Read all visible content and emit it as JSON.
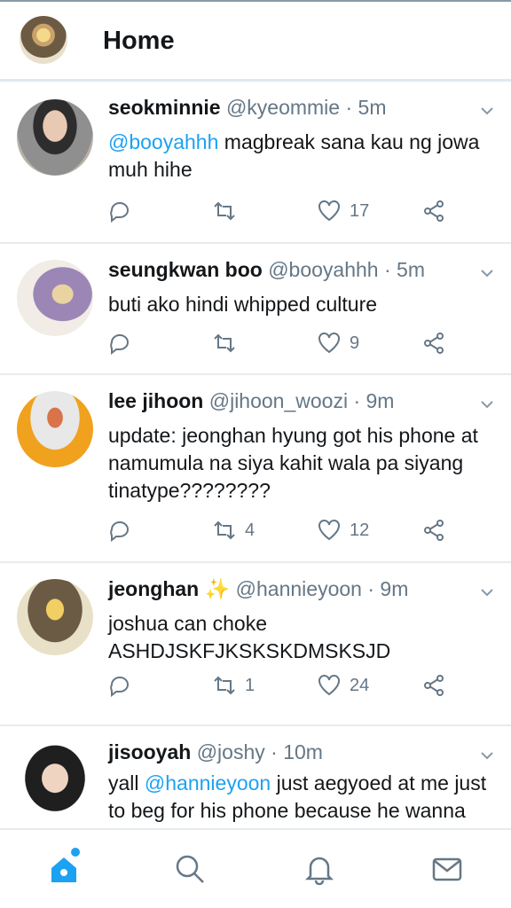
{
  "header": {
    "title": "Home"
  },
  "tweets": [
    {
      "name": "seokminnie",
      "handle": "@kyeommie",
      "dot": "·",
      "time": "5m",
      "mention": "@booyahhh",
      "text": " magbreak sana kau ng jowa muh hihe",
      "text_after": "",
      "mention2": "",
      "retweets": "",
      "likes": "17"
    },
    {
      "name": "seungkwan boo",
      "handle": "@booyahhh",
      "dot": "·",
      "time": "5m",
      "mention": "",
      "text": "buti ako hindi whipped culture",
      "retweets": "",
      "likes": "9"
    },
    {
      "name": "lee jihoon",
      "handle": "@jihoon_woozi",
      "dot": "·",
      "time": "9m",
      "mention": "",
      "text": "update: jeonghan hyung got his phone at namumula na siya kahit wala pa siyang tinatype????????",
      "retweets": "4",
      "likes": "12"
    },
    {
      "name": "jeonghan",
      "emoji": "✨",
      "handle": "@hannieyoon",
      "dot": "·",
      "time": "9m",
      "mention": "",
      "text": "joshua can choke ASHDJSKFJKSKSKDMSKSJD",
      "retweets": "1",
      "likes": "24"
    },
    {
      "name": "jisooyah",
      "handle": "@joshy",
      "dot": "·",
      "time": "10m",
      "text_before": "yall ",
      "mention": "@hannieyoon",
      "text": " just aegyoed at me just to beg for his phone because he wanna",
      "retweets": "",
      "likes": ""
    }
  ],
  "icons": {
    "reply": "reply-icon",
    "retweet": "retweet-icon",
    "like": "heart-icon",
    "share": "share-icon",
    "caret": "chevron-down-icon"
  },
  "nav": [
    "home-icon",
    "search-icon",
    "notifications-icon",
    "messages-icon"
  ],
  "colors": {
    "accent": "#1da1f2",
    "muted": "#657786",
    "text": "#14171a"
  }
}
